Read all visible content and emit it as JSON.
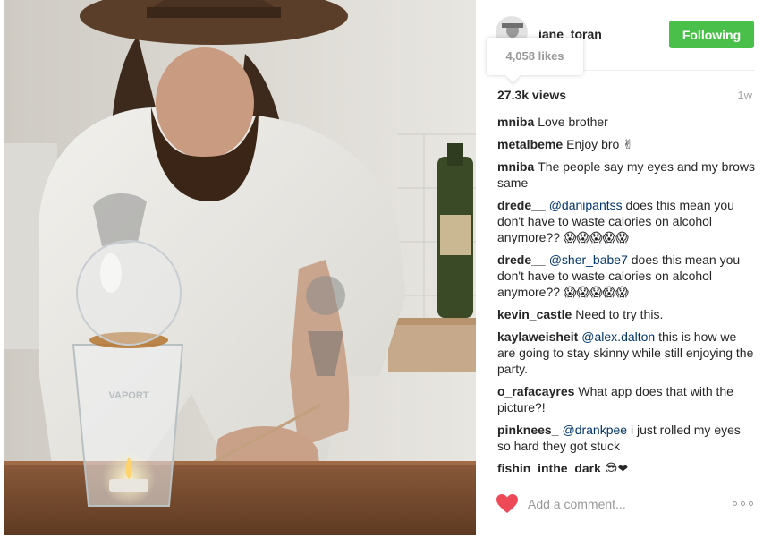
{
  "post": {
    "author": "jane_toran",
    "follow_label": "Following",
    "likes_tooltip": "4,058 likes",
    "views": "27.3k views",
    "age": "1w"
  },
  "comments": [
    {
      "author": "mniba",
      "text": "Love brother"
    },
    {
      "author": "metalbeme",
      "text": "Enjoy bro ✌"
    },
    {
      "author": "mniba",
      "text": "The people say my eyes and my brows same"
    },
    {
      "author": "drede__",
      "mention": "@danipantss",
      "text": " does this mean you don't have to waste calories on alcohol anymore?? 😱😱😱😱😱"
    },
    {
      "author": "drede__",
      "mention": "@sher_babe7",
      "text": " does this mean you don't have to waste calories on alcohol anymore?? 😱😱😱😱😱"
    },
    {
      "author": "kevin_castle",
      "text": "Need to try this."
    },
    {
      "author": "kaylaweisheit",
      "mention": "@alex.dalton",
      "text": " this is how we are going to stay skinny while still enjoying the party."
    },
    {
      "author": "o_rafacayres",
      "text": "What app does that with the picture?!"
    },
    {
      "author": "pinknees_",
      "mention": "@drankpee",
      "text": " i just rolled my eyes so hard they got stuck"
    },
    {
      "author": "fishin_inthe_dark",
      "text": "😎❤"
    }
  ],
  "footer": {
    "comment_placeholder": "Add a comment..."
  },
  "photo_text": {
    "glass_brand": "VAPORT"
  },
  "colors": {
    "follow_button": "#4ac04a",
    "like_heart": "#ed4956",
    "mention": "#003569",
    "muted": "#999999"
  },
  "icons": {
    "like": "heart-icon",
    "more": "ellipsis-icon"
  }
}
